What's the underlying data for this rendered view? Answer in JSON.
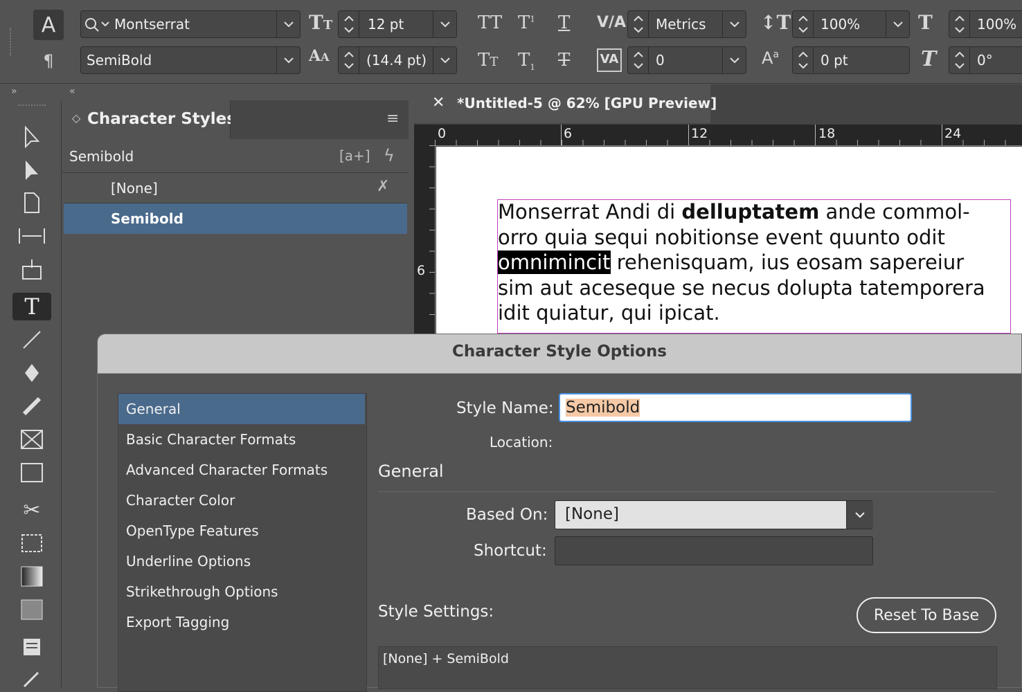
{
  "control_bar": {
    "font_family": "Montserrat",
    "font_style": "SemiBold",
    "font_size": "12 pt",
    "leading": "(14.4 pt)",
    "kerning": "Metrics",
    "tracking": "0",
    "vertical_scale": "100%",
    "horizontal_scale": "100%",
    "baseline_shift": "0 pt",
    "skew": "0°"
  },
  "panel": {
    "title": "Character Styles",
    "group": "Semibold",
    "items": [
      {
        "label": "[None]"
      },
      {
        "label": "Semibold"
      }
    ]
  },
  "document": {
    "tab_title": "*Untitled-5 @ 62% [GPU Preview]",
    "ruler_h": [
      "0",
      "6",
      "12",
      "18",
      "24"
    ],
    "ruler_v": [
      "6"
    ],
    "text": {
      "l1a": "Monserrat Andi di ",
      "l1b": "delluptatem",
      "l1c": " ande commol-",
      "l2": "orro quia sequi nobitionse event quunto odit",
      "l3a": "omnimincit",
      "l3b": " rehenisquam, ius eosam sapereiur",
      "l4": "sim aut aceseque se necus dolupta tatemporera",
      "l5": "idit quiatur, qui ipicat."
    }
  },
  "dialog": {
    "title": "Character Style Options",
    "nav": [
      "General",
      "Basic Character Formats",
      "Advanced Character Formats",
      "Character Color",
      "OpenType Features",
      "Underline Options",
      "Strikethrough Options",
      "Export Tagging"
    ],
    "style_name_label": "Style Name:",
    "style_name_value": "Semibold",
    "location_label": "Location:",
    "section_general": "General",
    "based_on_label": "Based On:",
    "based_on_value": "[None]",
    "shortcut_label": "Shortcut:",
    "shortcut_value": "",
    "style_settings_label": "Style Settings:",
    "reset_button": "Reset To Base",
    "settings_text": "[None] + SemiBold"
  },
  "colors": {
    "selection": "#4a6a8c",
    "accent_focus": "#4a90e2",
    "text_highlight": "#f5c9a5"
  }
}
